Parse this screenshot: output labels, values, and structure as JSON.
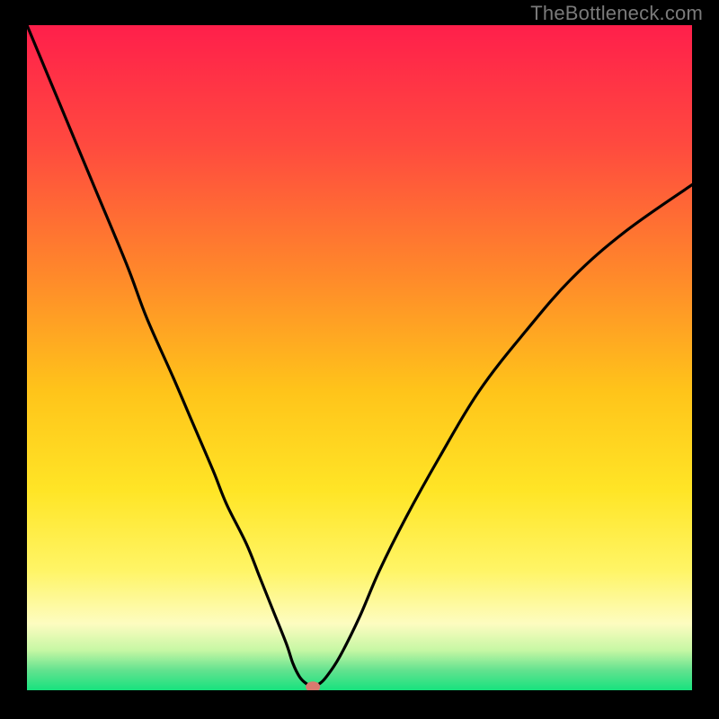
{
  "watermark": "TheBottleneck.com",
  "chart_data": {
    "type": "line",
    "title": "",
    "xlabel": "",
    "ylabel": "",
    "xlim": [
      0,
      100
    ],
    "ylim": [
      0,
      100
    ],
    "x": [
      0,
      5,
      10,
      15,
      18,
      22,
      25,
      28,
      30,
      33,
      35,
      37,
      39,
      40,
      41,
      42,
      43,
      44,
      45,
      47,
      50,
      53,
      57,
      62,
      68,
      75,
      82,
      90,
      100
    ],
    "values": [
      100,
      88,
      76,
      64,
      56,
      47,
      40,
      33,
      28,
      22,
      17,
      12,
      7,
      4,
      2,
      1,
      0.5,
      1,
      2,
      5,
      11,
      18,
      26,
      35,
      45,
      54,
      62,
      69,
      76
    ],
    "series": [
      {
        "name": "bottleneck-curve",
        "color": "#000000",
        "x": [
          0,
          5,
          10,
          15,
          18,
          22,
          25,
          28,
          30,
          33,
          35,
          37,
          39,
          40,
          41,
          42,
          43,
          44,
          45,
          47,
          50,
          53,
          57,
          62,
          68,
          75,
          82,
          90,
          100
        ],
        "y": [
          100,
          88,
          76,
          64,
          56,
          47,
          40,
          33,
          28,
          22,
          17,
          12,
          7,
          4,
          2,
          1,
          0.5,
          1,
          2,
          5,
          11,
          18,
          26,
          35,
          45,
          54,
          62,
          69,
          76
        ]
      }
    ],
    "marker": {
      "x": 43,
      "y": 0.5,
      "color": "#d87a6f"
    },
    "background": {
      "type": "vertical-gradient",
      "stops": [
        {
          "pos": 0.0,
          "color": "#ff1f4b"
        },
        {
          "pos": 0.18,
          "color": "#ff4a3f"
        },
        {
          "pos": 0.38,
          "color": "#ff8a2a"
        },
        {
          "pos": 0.55,
          "color": "#ffc41a"
        },
        {
          "pos": 0.7,
          "color": "#ffe526"
        },
        {
          "pos": 0.82,
          "color": "#fff566"
        },
        {
          "pos": 0.9,
          "color": "#fdfcc0"
        },
        {
          "pos": 0.94,
          "color": "#c6f7a4"
        },
        {
          "pos": 0.97,
          "color": "#63e28f"
        },
        {
          "pos": 1.0,
          "color": "#17e27e"
        }
      ]
    }
  }
}
